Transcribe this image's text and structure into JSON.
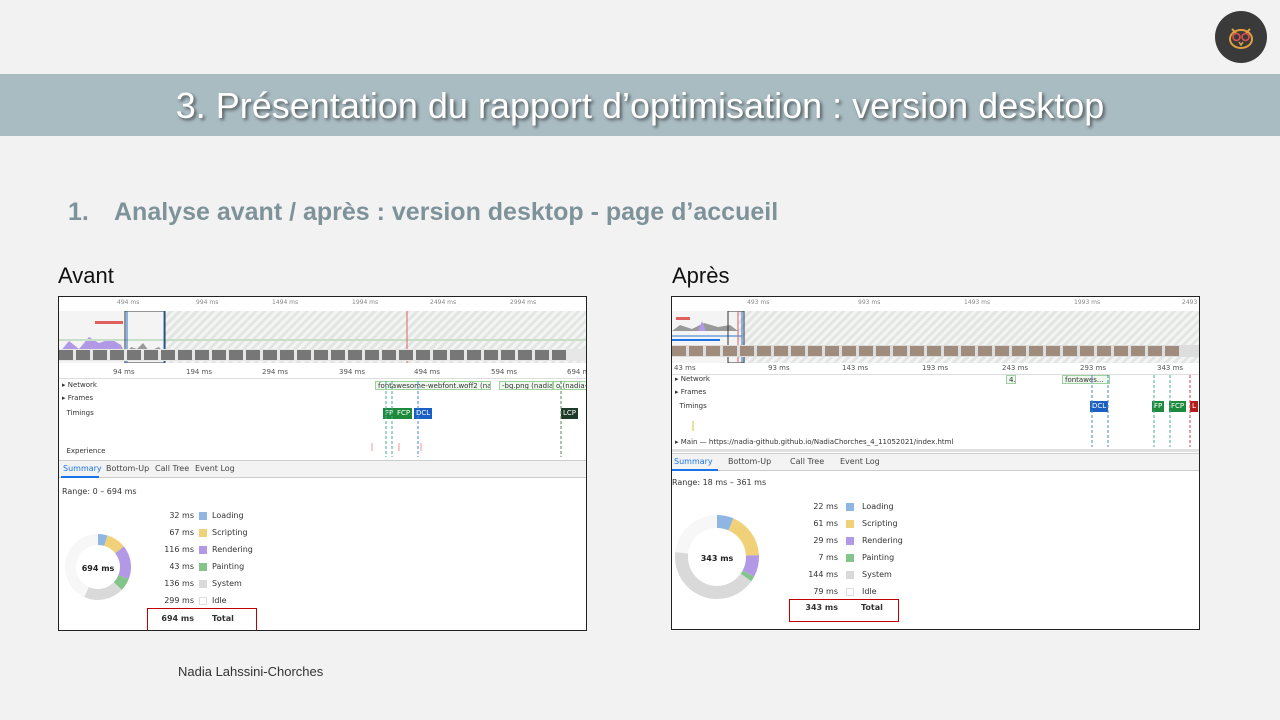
{
  "slide": {
    "title": "3. Présentation du rapport d’optimisation : version desktop",
    "subtitle_num": "1.",
    "subtitle": "Analyse avant / après : version desktop - page d’accueil",
    "footer": "Nadia Lahssini-Chorches",
    "logo_icon": "owl-logo-icon"
  },
  "colors": {
    "banner": "#a9bcc2",
    "loading": "#8fb5e3",
    "scripting": "#f1d178",
    "rendering": "#b299e6",
    "painting": "#82c489",
    "system": "#d9d9d9",
    "idle": "#ffffff",
    "highlight_box": "#c00000"
  },
  "avant": {
    "label": "Avant",
    "overview_ticks": [
      "494 ms",
      "994 ms",
      "1494 ms",
      "1994 ms",
      "2494 ms",
      "2994 ms"
    ],
    "ruler_ticks": [
      "94 ms",
      "194 ms",
      "294 ms",
      "394 ms",
      "494 ms",
      "594 ms",
      "694 ms"
    ],
    "tracks": [
      "Network",
      "Frames",
      "Timings",
      "Experience"
    ],
    "network_items": [
      "fontawesome-webfont.woff2 (nadia...",
      "-bg.png (nadia...",
      "o (nadia-gi"
    ],
    "timing_marks": [
      "FP",
      "FCP",
      "DCL",
      "LCP"
    ],
    "tabs": [
      "Summary",
      "Bottom-Up",
      "Call Tree",
      "Event Log"
    ],
    "range": "Range: 0 – 694 ms",
    "donut_total": "694 ms",
    "summary": [
      {
        "ms": "32 ms",
        "label": "Loading",
        "value": 32
      },
      {
        "ms": "67 ms",
        "label": "Scripting",
        "value": 67
      },
      {
        "ms": "116 ms",
        "label": "Rendering",
        "value": 116
      },
      {
        "ms": "43 ms",
        "label": "Painting",
        "value": 43
      },
      {
        "ms": "136 ms",
        "label": "System",
        "value": 136
      },
      {
        "ms": "299 ms",
        "label": "Idle",
        "value": 299
      }
    ],
    "total": {
      "ms": "694 ms",
      "label": "Total"
    }
  },
  "apres": {
    "label": "Après",
    "overview_ticks": [
      "493 ms",
      "993 ms",
      "1493 ms",
      "1993 ms",
      "2493"
    ],
    "ruler_ticks": [
      "43 ms",
      "93 ms",
      "143 ms",
      "193 ms",
      "243 ms",
      "293 ms",
      "343 ms"
    ],
    "tracks": [
      "Network",
      "Frames",
      "Timings"
    ],
    "network_items": [
      "4.",
      "fontawes..."
    ],
    "timing_marks": [
      "DCL",
      "FP",
      "FCP",
      "L"
    ],
    "main_track": "Main — https://nadia-github.github.io/NadiaChorches_4_11052021/index.html",
    "tabs": [
      "Summary",
      "Bottom-Up",
      "Call Tree",
      "Event Log"
    ],
    "range": "Range: 18 ms – 361 ms",
    "donut_total": "343 ms",
    "summary": [
      {
        "ms": "22 ms",
        "label": "Loading",
        "value": 22
      },
      {
        "ms": "61 ms",
        "label": "Scripting",
        "value": 61
      },
      {
        "ms": "29 ms",
        "label": "Rendering",
        "value": 29
      },
      {
        "ms": "7 ms",
        "label": "Painting",
        "value": 7
      },
      {
        "ms": "144 ms",
        "label": "System",
        "value": 144
      },
      {
        "ms": "79 ms",
        "label": "Idle",
        "value": 79
      }
    ],
    "total": {
      "ms": "343 ms",
      "label": "Total"
    }
  }
}
